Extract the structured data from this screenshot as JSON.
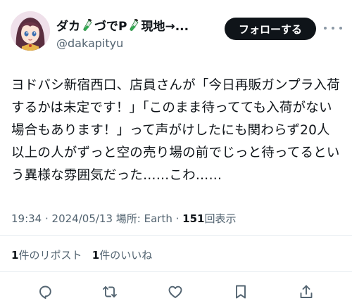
{
  "author": {
    "display_name_part1": "ダカ",
    "display_name_part2": "づでP",
    "display_name_part3": "現地→...",
    "handle": "@dakapityu",
    "avatar_icon": "anime-girl-avatar-icon",
    "name_emoji_icon": "test-tube-icon"
  },
  "follow_button_label": "フォローする",
  "more_menu_icon": "more-horizontal-icon",
  "tweet": {
    "text": "ヨドバシ新宿西口、店員さんが「今日再販ガンプラ入荷するかは未定です！」「このまま待ってても入荷がない場合もあります！」って声がけしたにも関わらず20人以上の人がずっと空の売り場の前でじっと待ってるという異様な雰囲気だった……こわ……"
  },
  "meta": {
    "time": "19:34",
    "separator": " · ",
    "date": "2024/05/13",
    "location_label": "場所: Earth",
    "views_count": "151",
    "views_label": "回表示"
  },
  "stats": {
    "reposts_count": "1",
    "reposts_label": "件のリポスト",
    "likes_count": "1",
    "likes_label": "件のいいね"
  },
  "actions": {
    "reply_icon": "reply-icon",
    "repost_icon": "repost-icon",
    "like_icon": "heart-icon",
    "bookmark_icon": "bookmark-icon",
    "share_icon": "share-icon"
  },
  "colors": {
    "text_primary": "#0f1419",
    "text_secondary": "#536471",
    "follow_bg": "#0f1419",
    "follow_text": "#ffffff",
    "divider": "#e6ecf0",
    "test_tube": "#2fa84f"
  }
}
